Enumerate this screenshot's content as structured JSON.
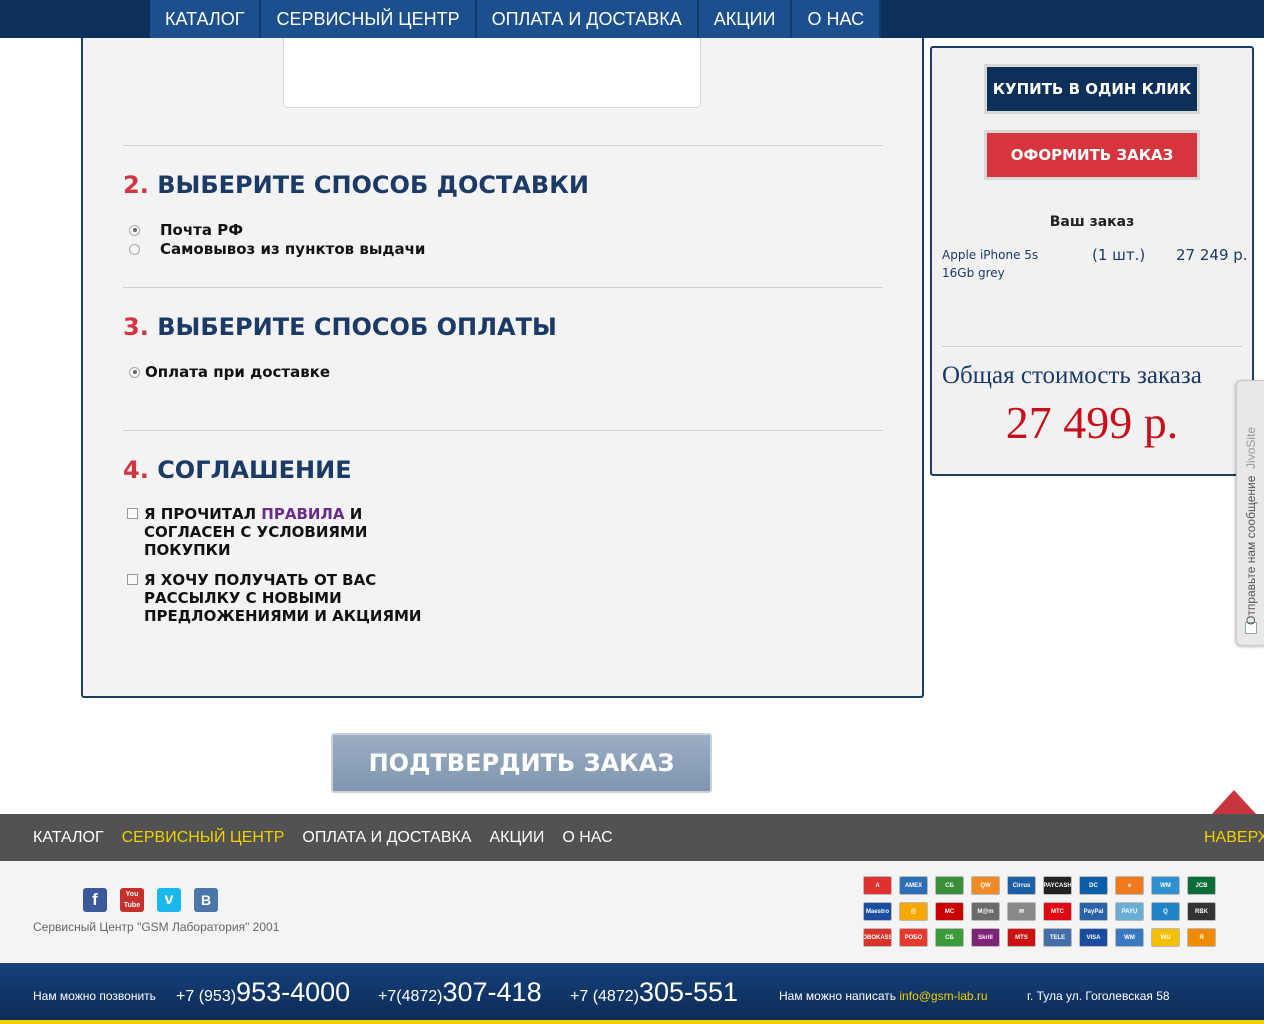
{
  "top_nav": {
    "items": [
      "КАТАЛОГ",
      "СЕРВИСНЫЙ ЦЕНТР",
      "ОПЛАТА И ДОСТАВКА",
      "АКЦИИ",
      "О НАС"
    ]
  },
  "delivery": {
    "number": "2.",
    "title": "ВЫБЕРИТЕ СПОСОБ ДОСТАВКИ",
    "options": [
      "Почта РФ",
      "Самовывоз из пунктов выдачи"
    ],
    "selected": "Почта РФ"
  },
  "payment": {
    "number": "3.",
    "title": "ВЫБЕРИТЕ СПОСОБ ОПЛАТЫ",
    "options": [
      "Оплата при доставке"
    ],
    "selected": "Оплата при доставке"
  },
  "agreement": {
    "number": "4.",
    "title": "СОГЛАШЕНИЕ",
    "rules_prefix": "Я ПРОЧИТАЛ ",
    "rules_link": "ПРАВИЛА",
    "rules_suffix": " И СОГЛАСЕН С УСЛОВИЯМИ ПОКУПКИ",
    "newsletter": "Я ХОЧУ ПОЛУЧАТЬ ОТ ВАС РАССЫЛКУ С НОВЫМИ ПРЕДЛОЖЕНИЯМИ И АКЦИЯМИ"
  },
  "sidebar": {
    "one_click_label": "КУПИТЬ В ОДИН КЛИК",
    "checkout_label": "ОФОРМИТЬ ЗАКАЗ",
    "order_heading": "Ваш заказ",
    "item_name": "Apple iPhone 5s 16Gb grey",
    "item_qty": "(1 шт.)",
    "item_price": "27 249 р.",
    "total_label": "Общая стоимость заказа",
    "total_value": "27 499 р."
  },
  "jivosite": {
    "text": "Отправьте нам сообщение",
    "brand": "JivoSite"
  },
  "confirm_label": "ПОДТВЕРДИТЬ ЗАКАЗ",
  "footer_nav": {
    "items": [
      "КАТАЛОГ",
      "СЕРВИСНЫЙ ЦЕНТР",
      "ОПЛАТА И ДОСТАВКА",
      "АКЦИИ",
      "О НАС"
    ],
    "active": "СЕРВИСНЫЙ ЦЕНТР",
    "to_top": "НАВЕРХ"
  },
  "social": [
    {
      "name": "facebook-icon",
      "glyph": "f",
      "color": "#3b5998"
    },
    {
      "name": "youtube-icon",
      "glyph": "You Tube",
      "color": "#c4302b"
    },
    {
      "name": "vimeo-icon",
      "glyph": "v",
      "color": "#1ab7ea"
    },
    {
      "name": "vk-icon",
      "glyph": "B",
      "color": "#4a76a8"
    }
  ],
  "copyright": "Сервисный Центр \"GSM Лаборатория\" 2001",
  "payment_icons": [
    {
      "label": "А",
      "color": "#e0312f"
    },
    {
      "label": "AMEX",
      "color": "#2c6fb6"
    },
    {
      "label": "СБ",
      "color": "#3a8f3a"
    },
    {
      "label": "QW",
      "color": "#f08a24"
    },
    {
      "label": "Cirrus",
      "color": "#1a5fa8"
    },
    {
      "label": "PAYCASH",
      "color": "#222222"
    },
    {
      "label": "DC",
      "color": "#0b5ea8"
    },
    {
      "label": "e",
      "color": "#f07a1c"
    },
    {
      "label": "WM",
      "color": "#2f8fd0"
    },
    {
      "label": "JCB",
      "color": "#0b6d3a"
    },
    {
      "label": "Maestro",
      "color": "#1a4da0"
    },
    {
      "label": "@",
      "color": "#f6a800"
    },
    {
      "label": "MC",
      "color": "#cc0000"
    },
    {
      "label": "M@m",
      "color": "#6b6b6b"
    },
    {
      "label": "✉",
      "color": "#888888"
    },
    {
      "label": "МТС",
      "color": "#e30613"
    },
    {
      "label": "PayPal",
      "color": "#2a63a8"
    },
    {
      "label": "PAYU",
      "color": "#6aaed6"
    },
    {
      "label": "Q",
      "color": "#1f84c6"
    },
    {
      "label": "RBK",
      "color": "#333333"
    },
    {
      "label": "ROBOKASSA",
      "color": "#d8342c"
    },
    {
      "label": "РОБО",
      "color": "#e63a2e"
    },
    {
      "label": "СБ",
      "color": "#3a9b3a"
    },
    {
      "label": "Skrill",
      "color": "#7d2378"
    },
    {
      "label": "MTS",
      "color": "#cc1111"
    },
    {
      "label": "TELE",
      "color": "#456fa8"
    },
    {
      "label": "VISA",
      "color": "#1a4ba0"
    },
    {
      "label": "WM",
      "color": "#3b78c2"
    },
    {
      "label": "WU",
      "color": "#f5c000"
    },
    {
      "label": "Я",
      "color": "#f08a00"
    }
  ],
  "bottom": {
    "call_label": "Нам можно позвонить",
    "phones": [
      {
        "code": "+7 (953)",
        "main": "953-4000"
      },
      {
        "code": "+7(4872)",
        "main": "307-418"
      },
      {
        "code": "+7 (4872)",
        "main": "305-551"
      }
    ],
    "write_label": "Нам можно написать",
    "email": "info@gsm-lab.ru",
    "address": "г. Тула ул. Гоголевская 58"
  }
}
